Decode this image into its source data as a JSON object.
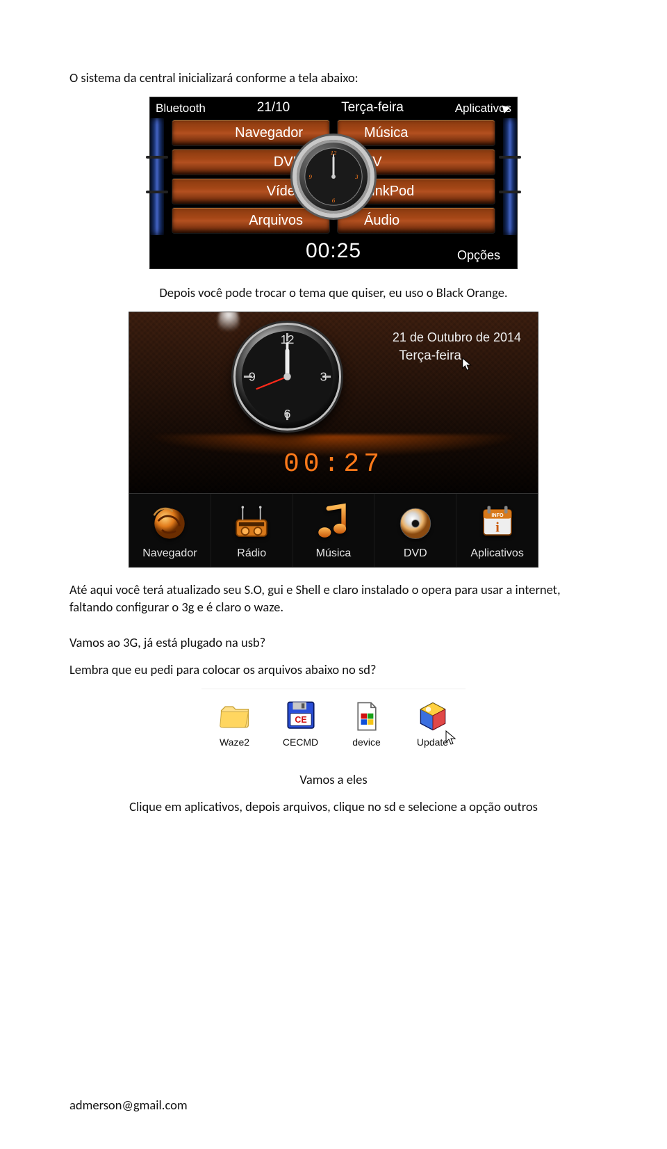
{
  "text": {
    "intro1": "O sistema da central inicializará conforme a tela abaixo:",
    "intro2": "Depois você pode trocar o tema que quiser, eu uso o Black Orange.",
    "intro3": "Até aqui você terá atualizado seu S.O, gui e Shell e claro instalado o opera para usar a internet, faltando configurar o 3g e é claro o waze.",
    "q3g": "Vamos ao 3G, já está plugado na usb?",
    "qsd": "Lembra que eu pedi para colocar os arquivos abaixo no sd?",
    "outro1": "Vamos a eles",
    "outro2": "Clique em aplicativos, depois arquivos, clique no sd e selecione a opção outros",
    "footer": "admerson@gmail.com"
  },
  "shot1": {
    "bluetooth": "Bluetooth",
    "date": "21/10",
    "day": "Terça-feira",
    "apps": "Aplicativos",
    "menu": [
      "Navegador",
      "Música",
      "DVD",
      "TV",
      "Vídeo",
      "LinkPod",
      "Arquivos",
      "Áudio"
    ],
    "time": "00:25",
    "options": "Opções"
  },
  "shot2": {
    "date_full": "21 de Outubro de 2014",
    "day": "Terça-feira",
    "time": "00:27",
    "dock": [
      "Navegador",
      "Rádio",
      "Música",
      "DVD",
      "Aplicativos"
    ]
  },
  "shot3": {
    "items": [
      "Waze2",
      "CECMD",
      "device",
      "Update"
    ]
  }
}
